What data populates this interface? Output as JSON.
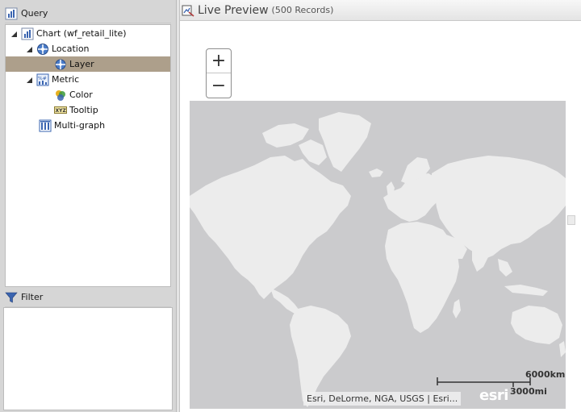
{
  "query_panel": {
    "title": "Query",
    "tree": [
      {
        "label": "Chart (wf_retail_lite)",
        "icon": "chart-icon",
        "expanded": true
      },
      {
        "label": "Location",
        "icon": "location-icon",
        "expanded": true
      },
      {
        "label": "Layer",
        "icon": "layer-icon",
        "selected": true
      },
      {
        "label": "Metric",
        "icon": "metric-icon",
        "expanded": true
      },
      {
        "label": "Color",
        "icon": "color-icon"
      },
      {
        "label": "Tooltip",
        "icon": "tooltip-icon"
      },
      {
        "label": "Multi-graph",
        "icon": "multigraph-icon"
      }
    ]
  },
  "filter_panel": {
    "title": "Filter"
  },
  "preview": {
    "title": "Live Preview",
    "records": "(500 Records)"
  },
  "map": {
    "zoom_in": "+",
    "zoom_out": "−",
    "scale_km": "6000km",
    "scale_mi": "3000mi",
    "attribution": "Esri, DeLorme, NGA, USGS | Esri...",
    "logo": "esri",
    "colors": {
      "ocean": "#cbcbcd",
      "land": "#ececec"
    }
  },
  "colors": {
    "selected_row": "#ad9f8b",
    "pane_bg": "#d6d6d6"
  }
}
